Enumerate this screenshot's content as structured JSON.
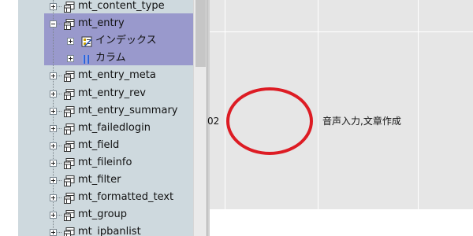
{
  "tree": {
    "items": [
      {
        "label": "mt_content_type",
        "toggle": "plus",
        "icon": "table-icon"
      },
      {
        "label": "mt_entry",
        "toggle": "minus",
        "icon": "table-icon",
        "selected": true
      },
      {
        "label": "インデックス",
        "toggle": "plus",
        "icon": "index-icon",
        "child": true
      },
      {
        "label": "カラム",
        "toggle": "plus",
        "icon": "columns-icon",
        "child": true
      },
      {
        "label": "mt_entry_meta",
        "toggle": "plus",
        "icon": "table-icon"
      },
      {
        "label": "mt_entry_rev",
        "toggle": "plus",
        "icon": "table-icon"
      },
      {
        "label": "mt_entry_summary",
        "toggle": "plus",
        "icon": "table-icon"
      },
      {
        "label": "mt_failedlogin",
        "toggle": "plus",
        "icon": "table-icon"
      },
      {
        "label": "mt_field",
        "toggle": "plus",
        "icon": "table-icon"
      },
      {
        "label": "mt_fileinfo",
        "toggle": "plus",
        "icon": "table-icon"
      },
      {
        "label": "mt_filter",
        "toggle": "plus",
        "icon": "table-icon"
      },
      {
        "label": "mt_formatted_text",
        "toggle": "plus",
        "icon": "table-icon"
      },
      {
        "label": "mt_group",
        "toggle": "plus",
        "icon": "table-icon"
      },
      {
        "label": "mt_ipbanlist",
        "toggle": "plus",
        "icon": "table-icon"
      }
    ]
  },
  "grid": {
    "cell_partial_text": "02",
    "cell_note_text": "音声入力,文章作成"
  },
  "colors": {
    "selection": "#9999cc",
    "tree_background": "#ced9de",
    "grid_background": "#e6e6e6",
    "annotation_circle": "#dd1c24"
  }
}
